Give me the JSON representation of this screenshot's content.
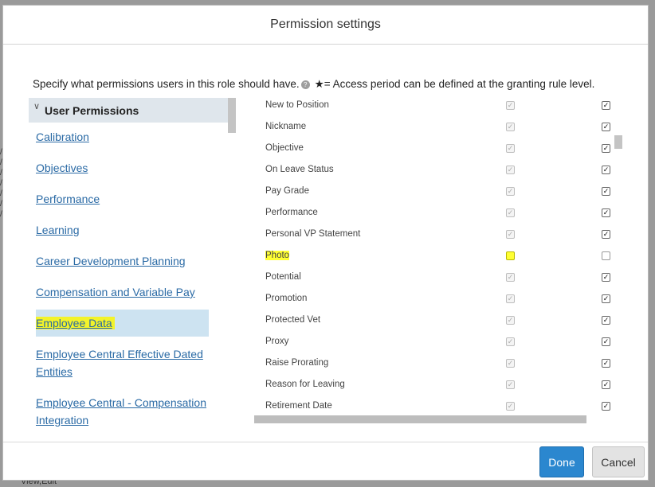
{
  "background": {
    "footer_text": "View,Edit"
  },
  "dialog": {
    "title": "Permission settings",
    "instructions_before_icon": "Specify what permissions users in this role should have.",
    "info_icon": "question-circle-icon",
    "instructions_after_icon": "★= Access period can be defined at the granting rule level."
  },
  "left_nav": {
    "section_title": "User Permissions",
    "items": [
      {
        "label": "Calibration"
      },
      {
        "label": "Objectives"
      },
      {
        "label": "Performance"
      },
      {
        "label": "Learning"
      },
      {
        "label": "Career Development Planning"
      },
      {
        "label": "Compensation and Variable Pay"
      },
      {
        "label": "Employee Data"
      },
      {
        "label": "Employee Central Effective Dated Entities"
      },
      {
        "label": "Employee Central - Compensation Integration"
      }
    ],
    "selected": "Employee Data"
  },
  "fields": [
    {
      "label": "New to Position",
      "col1": true,
      "col2": true
    },
    {
      "label": "Nickname",
      "col1": true,
      "col2": true
    },
    {
      "label": "Objective",
      "col1": true,
      "col2": true
    },
    {
      "label": "On Leave Status",
      "col1": true,
      "col2": true
    },
    {
      "label": "Pay Grade",
      "col1": true,
      "col2": true
    },
    {
      "label": "Performance",
      "col1": true,
      "col2": true
    },
    {
      "label": "Personal VP Statement",
      "col1": true,
      "col2": true
    },
    {
      "label": "Photo",
      "col1": false,
      "col2": false
    },
    {
      "label": "Potential",
      "col1": true,
      "col2": true
    },
    {
      "label": "Promotion",
      "col1": true,
      "col2": true
    },
    {
      "label": "Protected Vet",
      "col1": true,
      "col2": true
    },
    {
      "label": "Proxy",
      "col1": true,
      "col2": true
    },
    {
      "label": "Raise Prorating",
      "col1": true,
      "col2": true
    },
    {
      "label": "Reason for Leaving",
      "col1": true,
      "col2": true
    },
    {
      "label": "Retirement Date",
      "col1": true,
      "col2": true
    }
  ],
  "buttons": {
    "done": "Done",
    "cancel": "Cancel"
  },
  "colors": {
    "highlight": "#f3f32a",
    "link": "#2a6aa5",
    "primary": "#2b87cf"
  }
}
